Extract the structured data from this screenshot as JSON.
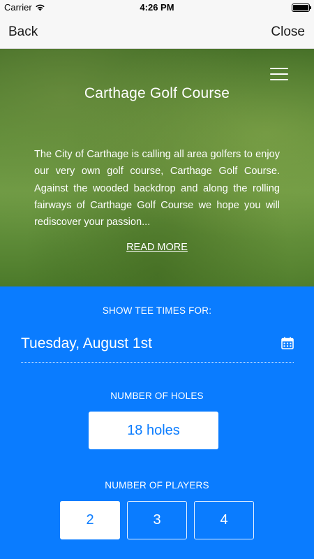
{
  "status_bar": {
    "carrier": "Carrier",
    "time": "4:26 PM",
    "wifi_icon": "wifi-icon",
    "battery_icon": "battery-icon"
  },
  "nav": {
    "back_label": "Back",
    "close_label": "Close"
  },
  "hero": {
    "menu_icon": "hamburger-menu-icon",
    "title": "Carthage Golf Course",
    "description": "The City of Carthage is calling all area golfers to enjoy our very own golf course, Carthage Golf Course. Against the wooded backdrop and along the rolling fairways of Carthage Golf Course we hope you will rediscover your passion...",
    "read_more": "READ MORE"
  },
  "booking": {
    "tee_label": "SHOW TEE TIMES FOR:",
    "date": "Tuesday, August 1st",
    "calendar_icon": "calendar-icon",
    "holes_label": "NUMBER OF HOLES",
    "holes_value": "18 holes",
    "players_label": "NUMBER OF PLAYERS",
    "players": [
      {
        "label": "2",
        "selected": true
      },
      {
        "label": "3",
        "selected": false
      },
      {
        "label": "4",
        "selected": false
      }
    ]
  },
  "colors": {
    "accent_blue": "#0a7cff",
    "bar_background": "#f7f7f7",
    "hero_green": "#5b8a36"
  }
}
